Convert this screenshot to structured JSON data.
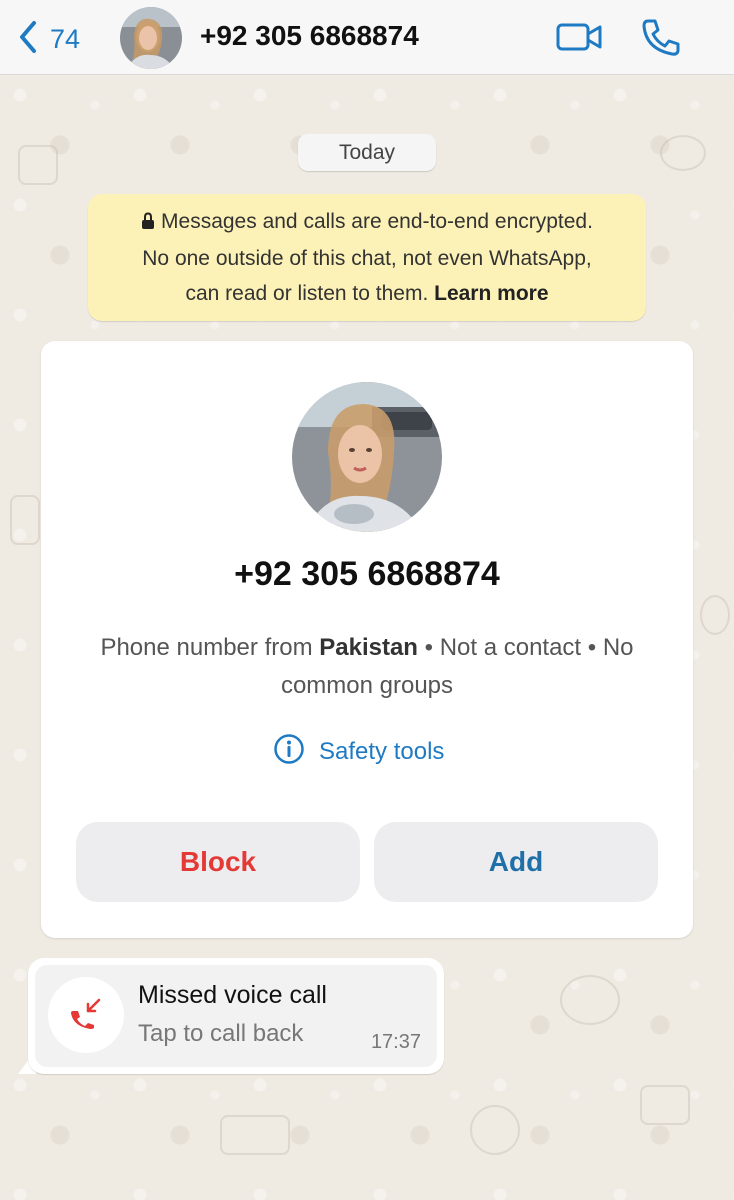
{
  "header": {
    "back_count": "74",
    "title": "+92 305 6868874"
  },
  "chat": {
    "date_label": "Today",
    "encryption": {
      "line1": "Messages and calls are end-to-end encrypted.",
      "line2": "No one outside of this chat, not even WhatsApp,",
      "line3": "can read or listen to them.",
      "link": "Learn more"
    },
    "contact_card": {
      "phone": "+92 305 6868874",
      "meta_prefix": "Phone number from ",
      "country": "Pakistan",
      "meta_suffix": " • Not a contact • No common groups",
      "safety_tools": "Safety tools",
      "block_label": "Block",
      "add_label": "Add"
    },
    "missed_call": {
      "title": "Missed voice call",
      "subtitle": "Tap to call back",
      "time": "17:37"
    }
  },
  "colors": {
    "accent": "#1f7ac4",
    "block": "#e53935",
    "notice_bg": "#fcf2b7",
    "missed_call_icon": "#e53935"
  }
}
